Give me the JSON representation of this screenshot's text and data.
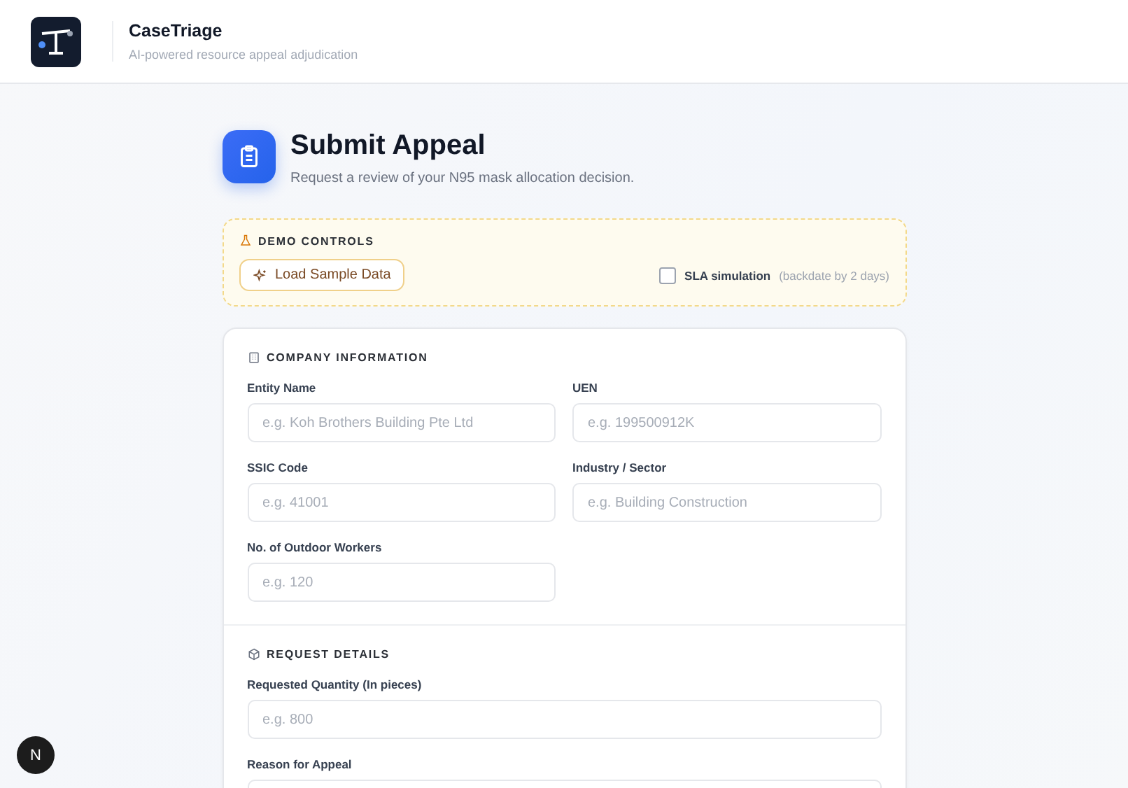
{
  "header": {
    "app_name": "CaseTriage",
    "tagline": "AI-powered resource appeal adjudication"
  },
  "page": {
    "title": "Submit Appeal",
    "subtitle": "Request a review of your N95 mask allocation decision."
  },
  "demo_controls": {
    "heading": "DEMO CONTROLS",
    "load_button": "Load Sample Data",
    "sla": {
      "label": "SLA simulation",
      "note": "(backdate by 2 days)",
      "checked": false
    }
  },
  "sections": [
    {
      "kind": "company",
      "heading": "COMPANY INFORMATION",
      "fields": [
        {
          "label": "Entity Name",
          "placeholder": "e.g. Koh Brothers Building Pte Ltd"
        },
        {
          "label": "UEN",
          "placeholder": "e.g. 199500912K"
        },
        {
          "label": "SSIC Code",
          "placeholder": "e.g. 41001"
        },
        {
          "label": "Industry / Sector",
          "placeholder": "e.g. Building Construction"
        },
        {
          "label": "No. of Outdoor Workers",
          "placeholder": "e.g. 120"
        }
      ]
    },
    {
      "kind": "request",
      "heading": "REQUEST DETAILS",
      "fields": [
        {
          "label": "Requested Quantity (In pieces)",
          "placeholder": "e.g. 800"
        },
        {
          "label": "Reason for Appeal"
        }
      ]
    }
  ],
  "dev_badge": "N"
}
